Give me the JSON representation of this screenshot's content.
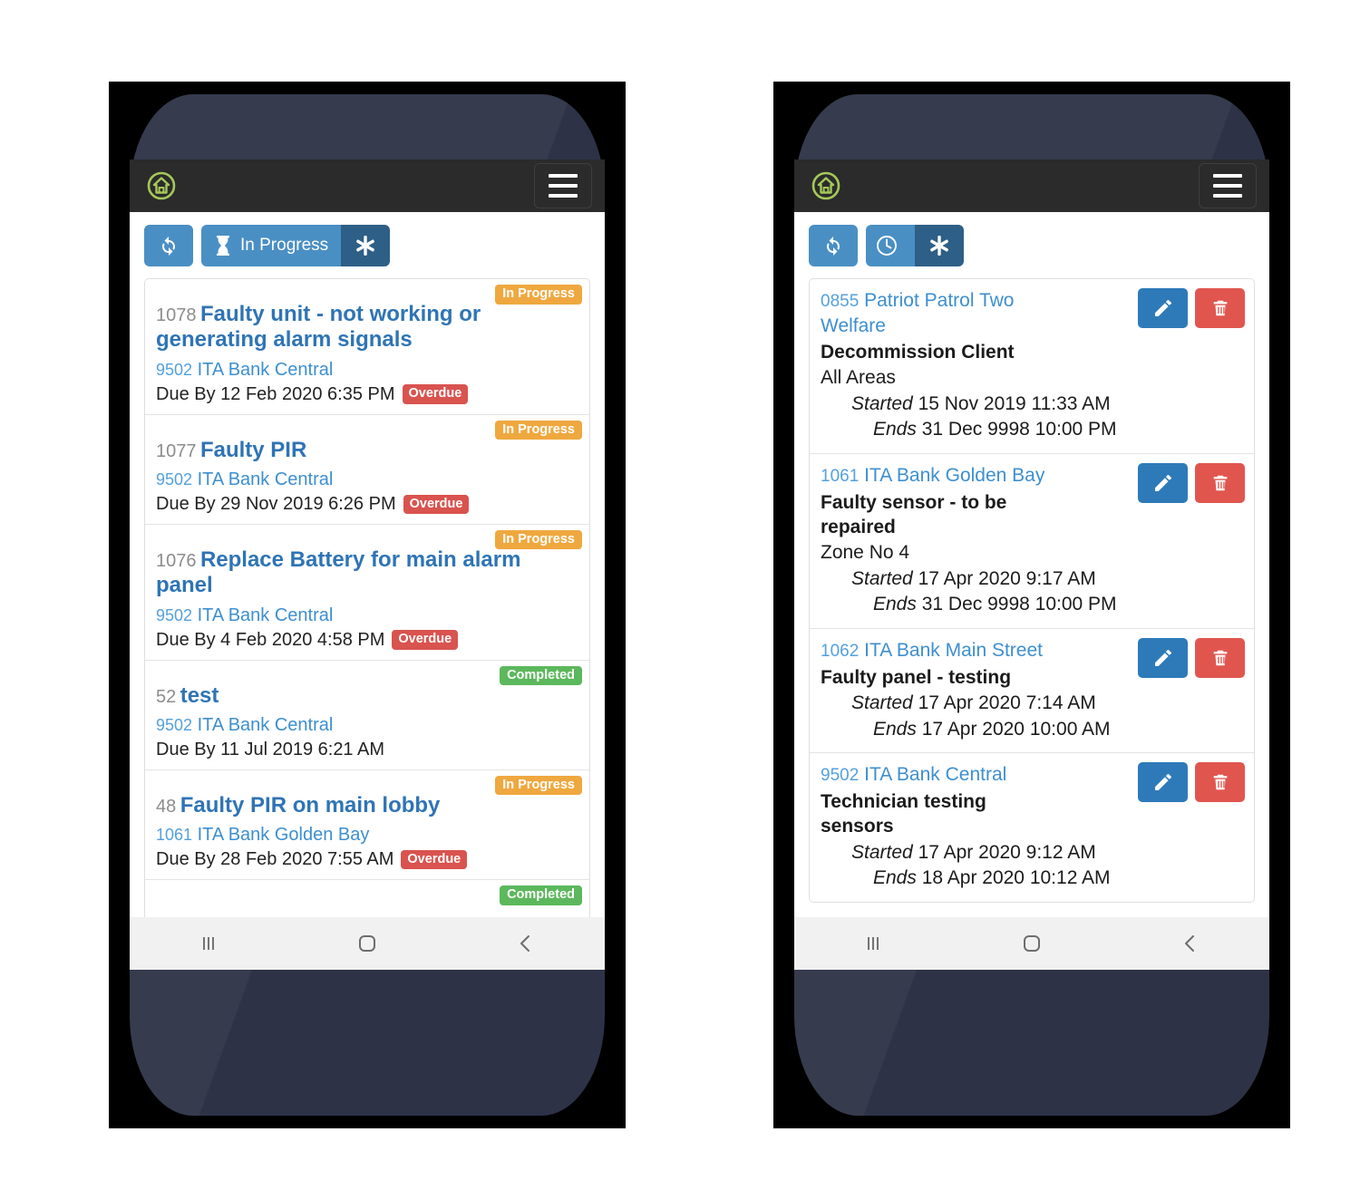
{
  "app": {
    "logo_icon": "home-circle-logo",
    "menu_icon": "hamburger-menu-icon"
  },
  "phones": [
    {
      "id": "jobs-phone",
      "toolbar": {
        "refresh_label": "",
        "refresh_icon": "refresh-icon",
        "filter_label": "In Progress",
        "filter_icon": "hourglass-icon",
        "extra_icon": "asterisk-icon"
      },
      "rows": [
        {
          "status": "In Progress",
          "status_type": "inprogress",
          "job_number": "1078",
          "title": "Faulty unit - not working or generating alarm signals",
          "site_number": "9502",
          "site_name": "ITA Bank Central",
          "due": "Due By 12 Feb 2020 6:35 PM",
          "flag": "Overdue"
        },
        {
          "status": "In Progress",
          "status_type": "inprogress",
          "job_number": "1077",
          "title": "Faulty PIR",
          "site_number": "9502",
          "site_name": "ITA Bank Central",
          "due": "Due By 29 Nov 2019 6:26 PM",
          "flag": "Overdue"
        },
        {
          "status": "In Progress",
          "status_type": "inprogress",
          "job_number": "1076",
          "title": "Replace Battery for main alarm panel",
          "site_number": "9502",
          "site_name": "ITA Bank Central",
          "due": "Due By 4 Feb 2020 4:58 PM",
          "flag": "Overdue"
        },
        {
          "status": "Completed",
          "status_type": "completed",
          "job_number": "52",
          "title": "test",
          "site_number": "9502",
          "site_name": "ITA Bank Central",
          "due": "Due By 11 Jul 2019 6:21 AM",
          "flag": ""
        },
        {
          "status": "In Progress",
          "status_type": "inprogress",
          "job_number": "48",
          "title": "Faulty PIR on main lobby",
          "site_number": "1061",
          "site_name": "ITA Bank Golden Bay",
          "due": "Due By 28 Feb 2020 7:55 AM",
          "flag": "Overdue"
        },
        {
          "status": "Completed",
          "status_type": "completed",
          "job_number": "",
          "title": "",
          "site_number": "",
          "site_name": "",
          "due": "",
          "flag": ""
        }
      ]
    },
    {
      "id": "schedule-phone",
      "toolbar": {
        "refresh_icon": "refresh-icon",
        "clock_icon": "clock-icon",
        "extra_icon": "asterisk-icon"
      },
      "rows": [
        {
          "client_number": "0855",
          "client_name": "Patriot Patrol Two Welfare",
          "description": "Decommission Client",
          "area": "All Areas",
          "started_label": "Started",
          "started_value": "15 Nov 2019 11:33 AM",
          "ends_label": "Ends",
          "ends_value": "31 Dec 9998 10:00 PM",
          "edit_icon": "pencil-icon",
          "delete_icon": "trash-icon"
        },
        {
          "client_number": "1061",
          "client_name": "ITA Bank Golden Bay",
          "description": "Faulty sensor - to be repaired",
          "area": "Zone No 4",
          "started_label": "Started",
          "started_value": "17 Apr 2020 9:17 AM",
          "ends_label": "Ends",
          "ends_value": "31 Dec 9998 10:00 PM",
          "edit_icon": "pencil-icon",
          "delete_icon": "trash-icon"
        },
        {
          "client_number": "1062",
          "client_name": "ITA Bank Main Street",
          "description": "Faulty panel - testing",
          "area": "",
          "started_label": "Started",
          "started_value": "17 Apr 2020 7:14 AM",
          "ends_label": "Ends",
          "ends_value": "17 Apr 2020 10:00 AM",
          "edit_icon": "pencil-icon",
          "delete_icon": "trash-icon"
        },
        {
          "client_number": "9502",
          "client_name": "ITA Bank Central",
          "description": "Technician testing sensors",
          "area": "",
          "started_label": "Started",
          "started_value": "17 Apr 2020 9:12 AM",
          "ends_label": "Ends",
          "ends_value": "18 Apr 2020 10:12 AM",
          "edit_icon": "pencil-icon",
          "delete_icon": "trash-icon"
        }
      ]
    }
  ],
  "navbar": {
    "recents_icon": "recent-apps-icon",
    "home_icon": "home-square-icon",
    "back_icon": "back-chevron-icon"
  },
  "colors": {
    "primary": "#4a8fc4",
    "primary_dark": "#2e5f86",
    "edit": "#2e7ab8",
    "delete": "#e0564f",
    "inprogress": "#efa83f",
    "completed": "#5cb85c",
    "overdue": "#d9534f",
    "link": "#3d8fd0",
    "appbar": "#2b2b2b",
    "logo": "#a5c85a"
  }
}
